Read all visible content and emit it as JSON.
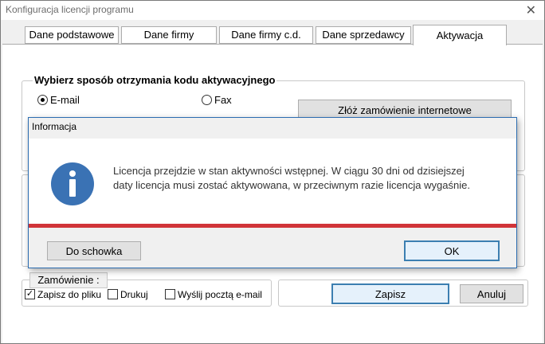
{
  "window": {
    "title": "Konfiguracja licencji programu",
    "close_glyph": "✕"
  },
  "tabs": [
    {
      "label": "Dane podstawowe",
      "active": false
    },
    {
      "label": "Dane firmy",
      "active": false
    },
    {
      "label": "Dane firmy c.d.",
      "active": false
    },
    {
      "label": "Dane sprzedawcy",
      "active": false
    },
    {
      "label": "Aktywacja",
      "active": true
    }
  ],
  "activation": {
    "group_title": "Wybierz sposób otrzymania kodu aktywacyjnego",
    "options": [
      {
        "label": "E-mail",
        "checked": true
      },
      {
        "label": "Fax",
        "checked": false
      }
    ],
    "order_online_button": "Złóż zamówienie internetowe"
  },
  "order": {
    "label": "Zamówienie :",
    "checkboxes": [
      {
        "label": "Zapisz do pliku",
        "checked": true
      },
      {
        "label": "Drukuj",
        "checked": false
      },
      {
        "label": "Wyślij pocztą e-mail",
        "checked": false
      }
    ]
  },
  "footer": {
    "save_label": "Zapisz",
    "cancel_label": "Anuluj"
  },
  "dialog": {
    "title": "Informacja",
    "icon": "info-icon",
    "message_line1": "Licencja przejdzie w stan aktywności wstępnej. W ciągu 30 dni od dzisiejszej",
    "message_line2": "daty licencja musi zostać aktywowana, w przeciwnym razie licencja wygaśnie.",
    "clipboard_button": "Do schowka",
    "ok_button": "OK",
    "accent_color": "#d13438",
    "icon_color": "#3a72b4"
  }
}
